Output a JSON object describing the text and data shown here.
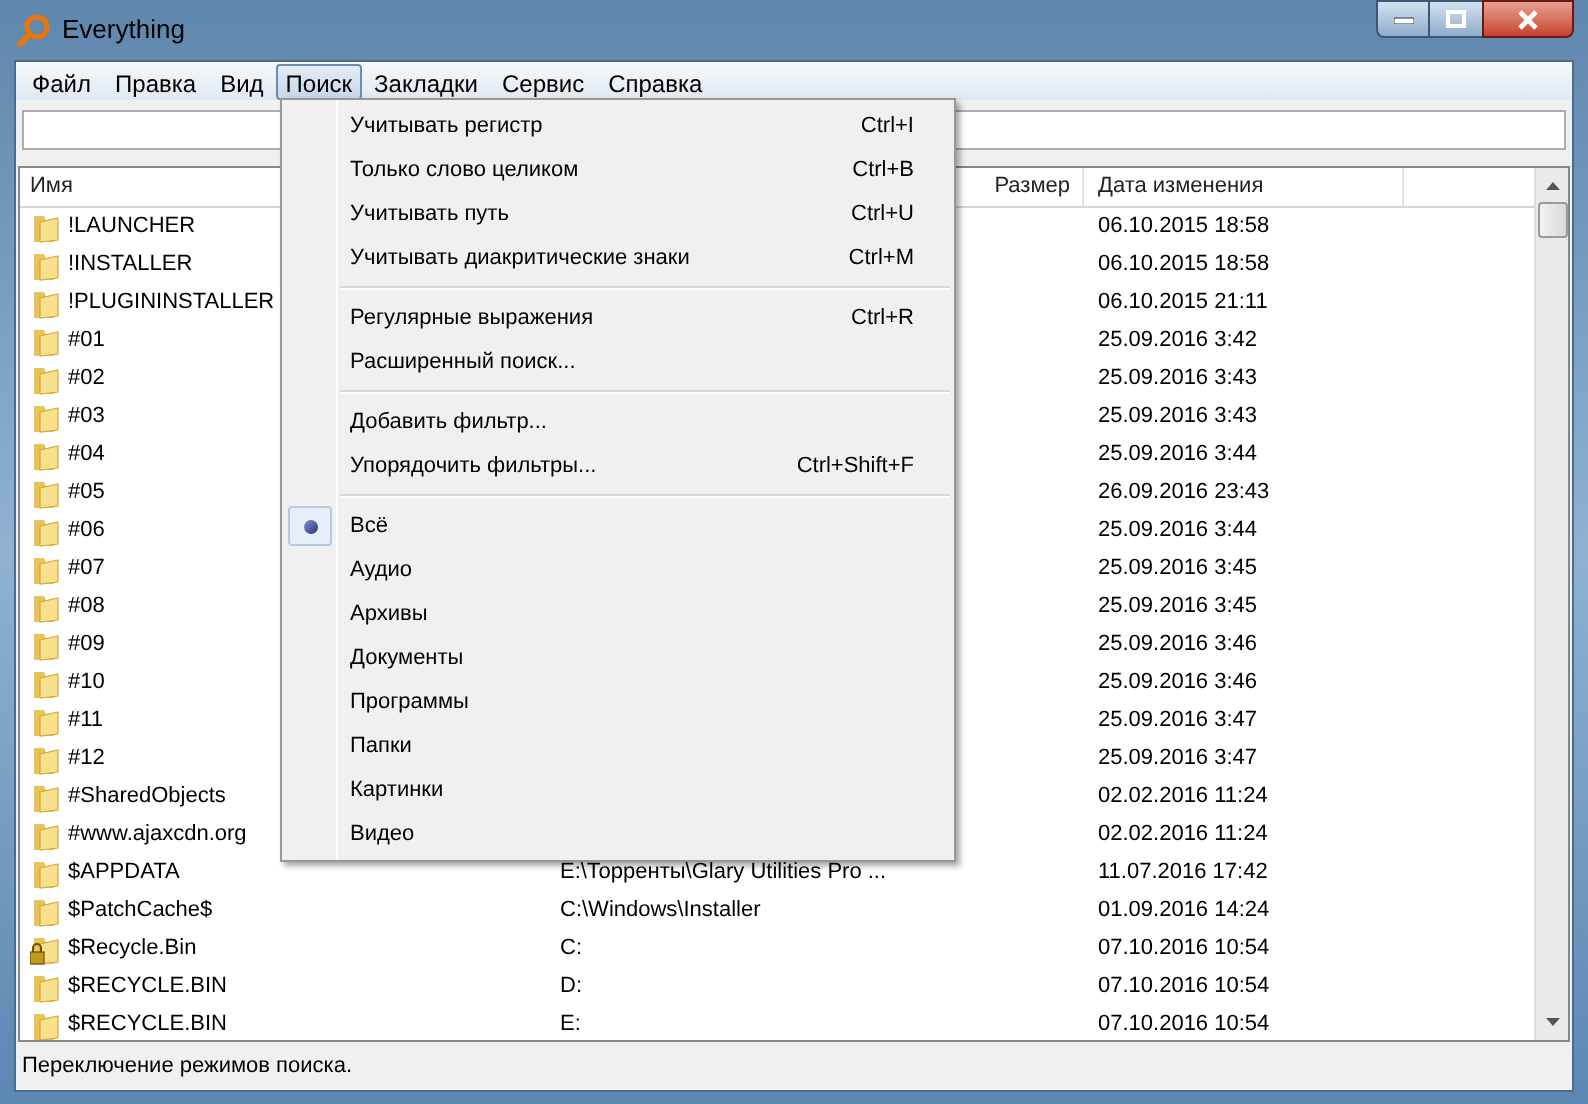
{
  "window": {
    "title": "Everything"
  },
  "menubar": [
    {
      "label": "Файл",
      "selected": false
    },
    {
      "label": "Правка",
      "selected": false
    },
    {
      "label": "Вид",
      "selected": false
    },
    {
      "label": "Поиск",
      "selected": true
    },
    {
      "label": "Закладки",
      "selected": false
    },
    {
      "label": "Сервис",
      "selected": false
    },
    {
      "label": "Справка",
      "selected": false
    }
  ],
  "table": {
    "columns": [
      "Имя",
      "Размер",
      "Дата изменения"
    ],
    "rows": [
      {
        "name": "!LAUNCHER",
        "path": "",
        "locked": false,
        "modified": "06.10.2015 18:58"
      },
      {
        "name": "!INSTALLER",
        "path": "",
        "locked": false,
        "modified": "06.10.2015 18:58"
      },
      {
        "name": "!PLUGININSTALLER",
        "path": "",
        "locked": false,
        "modified": "06.10.2015 21:11"
      },
      {
        "name": "#01",
        "path": "",
        "locked": false,
        "modified": "25.09.2016 3:42"
      },
      {
        "name": "#02",
        "path": "",
        "locked": false,
        "modified": "25.09.2016 3:43"
      },
      {
        "name": "#03",
        "path": "",
        "locked": false,
        "modified": "25.09.2016 3:43"
      },
      {
        "name": "#04",
        "path": "",
        "locked": false,
        "modified": "25.09.2016 3:44"
      },
      {
        "name": "#05",
        "path": "",
        "locked": false,
        "modified": "26.09.2016 23:43"
      },
      {
        "name": "#06",
        "path": "",
        "locked": false,
        "modified": "25.09.2016 3:44"
      },
      {
        "name": "#07",
        "path": "",
        "locked": false,
        "modified": "25.09.2016 3:45"
      },
      {
        "name": "#08",
        "path": "",
        "locked": false,
        "modified": "25.09.2016 3:45"
      },
      {
        "name": "#09",
        "path": "",
        "locked": false,
        "modified": "25.09.2016 3:46"
      },
      {
        "name": "#10",
        "path": "",
        "locked": false,
        "modified": "25.09.2016 3:46"
      },
      {
        "name": "#11",
        "path": "",
        "locked": false,
        "modified": "25.09.2016 3:47"
      },
      {
        "name": "#12",
        "path": "",
        "locked": false,
        "modified": "25.09.2016 3:47"
      },
      {
        "name": "#SharedObjects",
        "path": "",
        "locked": false,
        "modified": "02.02.2016 11:24"
      },
      {
        "name": "#www.ajaxcdn.org",
        "path": "",
        "locked": false,
        "modified": "02.02.2016 11:24"
      },
      {
        "name": "$APPDATA",
        "path": "E:\\Торренты\\Glary Utilities Pro ...",
        "locked": false,
        "modified": "11.07.2016 17:42"
      },
      {
        "name": "$PatchCache$",
        "path": "C:\\Windows\\Installer",
        "locked": false,
        "modified": "01.09.2016 14:24"
      },
      {
        "name": "$Recycle.Bin",
        "path": "C:",
        "locked": true,
        "modified": "07.10.2016 10:54"
      },
      {
        "name": "$RECYCLE.BIN",
        "path": "D:",
        "locked": false,
        "modified": "07.10.2016 10:54"
      },
      {
        "name": "$RECYCLE.BIN",
        "path": "E:",
        "locked": false,
        "modified": "07.10.2016 10:54"
      }
    ]
  },
  "menu": {
    "groups": [
      [
        {
          "kind": "command",
          "label": "Учитывать регистр",
          "shortcut": "Ctrl+I"
        },
        {
          "kind": "command",
          "label": "Только слово целиком",
          "shortcut": "Ctrl+B"
        },
        {
          "kind": "command",
          "label": "Учитывать путь",
          "shortcut": "Ctrl+U"
        },
        {
          "kind": "command",
          "label": "Учитывать диакритические знаки",
          "shortcut": "Ctrl+M"
        }
      ],
      [
        {
          "kind": "command",
          "label": "Регулярные выражения",
          "shortcut": "Ctrl+R"
        },
        {
          "kind": "command",
          "label": "Расширенный поиск..."
        }
      ],
      [
        {
          "kind": "command",
          "label": "Добавить фильтр..."
        },
        {
          "kind": "command",
          "label": "Упорядочить фильтры...",
          "shortcut": "Ctrl+Shift+F"
        }
      ],
      [
        {
          "kind": "radio",
          "label": "Всё",
          "selected": true
        },
        {
          "kind": "radio",
          "label": "Аудио",
          "selected": false
        },
        {
          "kind": "radio",
          "label": "Архивы",
          "selected": false
        },
        {
          "kind": "radio",
          "label": "Документы",
          "selected": false
        },
        {
          "kind": "radio",
          "label": "Программы",
          "selected": false
        },
        {
          "kind": "radio",
          "label": "Папки",
          "selected": false
        },
        {
          "kind": "radio",
          "label": "Картинки",
          "selected": false
        },
        {
          "kind": "radio",
          "label": "Видео",
          "selected": false
        }
      ]
    ]
  },
  "status_bar": "Переключение режимов поиска."
}
